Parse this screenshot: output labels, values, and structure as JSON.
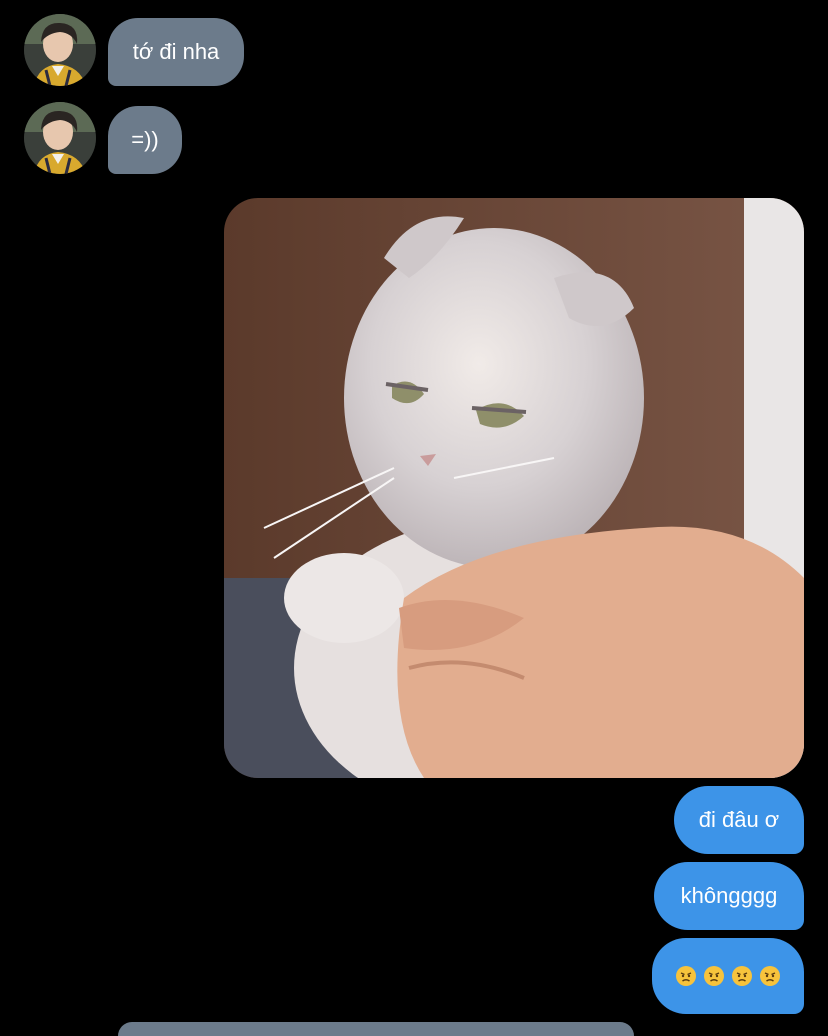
{
  "messages": [
    {
      "id": "m1",
      "from": "them",
      "text": "tớ đi nha"
    },
    {
      "id": "m2",
      "from": "them",
      "text": "=))"
    },
    {
      "id": "m3",
      "from": "me",
      "type": "image",
      "image_icon": "angry-scottish-fold-cat-photo"
    },
    {
      "id": "m4",
      "from": "me",
      "text": "đi đâu ơ"
    },
    {
      "id": "m5",
      "from": "me",
      "text": "khôngggg"
    },
    {
      "id": "m6",
      "from": "me",
      "emojis": [
        "angry-face",
        "angry-face",
        "angry-face",
        "angry-face"
      ]
    }
  ],
  "colors": {
    "background": "#000000",
    "incoming_bubble": "#6c7b8b",
    "outgoing_bubble": "#3d94e8",
    "text": "#ffffff"
  }
}
